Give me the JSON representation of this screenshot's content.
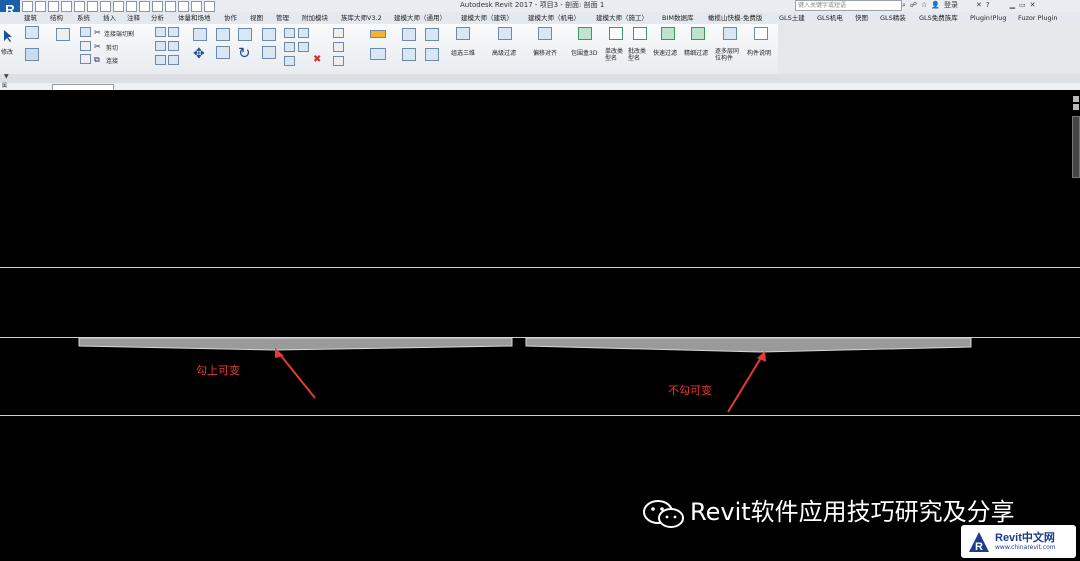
{
  "window": {
    "title": "Autodesk Revit 2017 -    项目3 - 剖面: 剖面 1",
    "search_placeholder": "键入关键字或短语",
    "login_label": "登录"
  },
  "tabs": [
    "建筑",
    "结构",
    "系统",
    "插入",
    "注释",
    "分析",
    "体量和场地",
    "协作",
    "视图",
    "管理",
    "附加模块",
    "族库大师V3.2",
    "建模大师（通用）",
    "建模大师（建筑）",
    "建模大师（机电）",
    "建模大师（施工）",
    "BIM数据库",
    "橄榄山快模-免费版",
    "GLS土建",
    "GLS机电",
    "快图",
    "GLS精装",
    "GLS免费族库",
    "Plugin!Plug",
    "Fuzor Plugin"
  ],
  "ribbon": {
    "modify_label": "修改",
    "clipboard_items": [
      "连接端切割",
      "剪切",
      "连接"
    ],
    "tool_labels": [
      "组选三维",
      "高级过滤",
      "偏移对齐",
      "包围盒3D",
      "单改类型名",
      "批改类型名",
      "快速过滤",
      "精细过滤",
      "逐多层同位构件",
      "构件说明"
    ]
  },
  "properties_bar": {
    "label": "属"
  },
  "canvas": {
    "annotations": [
      {
        "text": "勾上可变"
      },
      {
        "text": "不勾可变"
      }
    ],
    "annotation_color": "#e53935"
  },
  "watermark": {
    "text": "Revit软件应用技巧研究及分享"
  },
  "logo": {
    "name": "Revit中文网",
    "url": "www.chinarevit.com"
  }
}
